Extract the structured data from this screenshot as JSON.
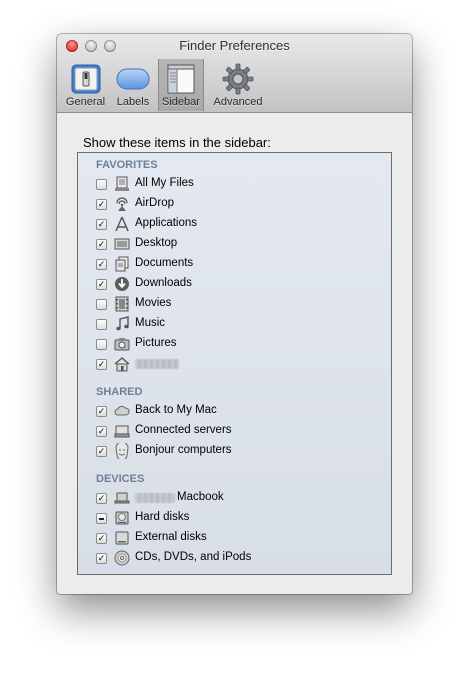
{
  "window": {
    "title": "Finder Preferences"
  },
  "toolbar": {
    "items": [
      {
        "label": "General",
        "icon": "general-switch-icon"
      },
      {
        "label": "Labels",
        "icon": "labels-pill-icon"
      },
      {
        "label": "Sidebar",
        "icon": "sidebar-icon",
        "selected": true
      },
      {
        "label": "Advanced",
        "icon": "gear-icon"
      }
    ]
  },
  "heading": "Show these items in the sidebar:",
  "sections": {
    "favorites": {
      "title": "FAVORITES",
      "items": [
        {
          "label": "All My Files",
          "checked": false,
          "icon": "all-my-files-icon"
        },
        {
          "label": "AirDrop",
          "checked": true,
          "icon": "airdrop-icon"
        },
        {
          "label": "Applications",
          "checked": true,
          "icon": "applications-icon"
        },
        {
          "label": "Desktop",
          "checked": true,
          "icon": "desktop-icon"
        },
        {
          "label": "Documents",
          "checked": true,
          "icon": "documents-icon"
        },
        {
          "label": "Downloads",
          "checked": true,
          "icon": "downloads-icon"
        },
        {
          "label": "Movies",
          "checked": false,
          "icon": "movies-icon"
        },
        {
          "label": "Music",
          "checked": false,
          "icon": "music-icon"
        },
        {
          "label": "Pictures",
          "checked": false,
          "icon": "pictures-icon"
        },
        {
          "label": "",
          "checked": true,
          "icon": "home-icon",
          "redacted": true
        }
      ]
    },
    "shared": {
      "title": "SHARED",
      "items": [
        {
          "label": "Back to My Mac",
          "checked": true,
          "icon": "cloud-icon"
        },
        {
          "label": "Connected servers",
          "checked": true,
          "icon": "server-icon"
        },
        {
          "label": "Bonjour computers",
          "checked": true,
          "icon": "bonjour-icon"
        }
      ]
    },
    "devices": {
      "title": "DEVICES",
      "items": [
        {
          "label": "Macbook",
          "checked": true,
          "icon": "laptop-icon",
          "redacted_prefix": true
        },
        {
          "label": "Hard disks",
          "checked": "mixed",
          "icon": "hard-disk-icon"
        },
        {
          "label": "External disks",
          "checked": true,
          "icon": "external-disk-icon"
        },
        {
          "label": "CDs, DVDs, and iPods",
          "checked": true,
          "icon": "cd-icon"
        }
      ]
    }
  },
  "colors": {
    "section_header": "#6f7f93",
    "close_button": "#e0443a",
    "list_background": "#dde3eb"
  }
}
